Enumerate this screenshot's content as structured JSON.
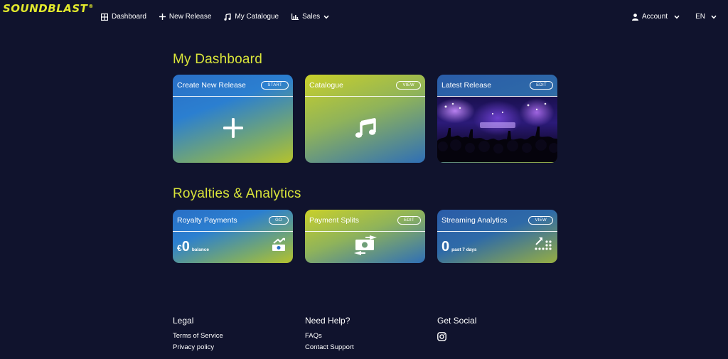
{
  "brand": {
    "logo": "SOUNDBLAST",
    "reg": "®",
    "accent": "#d9e43a",
    "background": "#10132d"
  },
  "nav": {
    "items": [
      {
        "label": "Dashboard",
        "icon": "grid-icon"
      },
      {
        "label": "New Release",
        "icon": "plus-icon"
      },
      {
        "label": "My Catalogue",
        "icon": "music-note-icon"
      },
      {
        "label": "Sales",
        "icon": "bar-chart-icon"
      }
    ],
    "account_label": "Account",
    "language_label": "EN"
  },
  "dashboard": {
    "title": "My Dashboard",
    "cards": [
      {
        "title": "Create New Release",
        "action": "START",
        "icon": "plus-icon"
      },
      {
        "title": "Catalogue",
        "action": "VIEW",
        "icon": "music-note-icon"
      },
      {
        "title": "Latest Release",
        "action": "EDIT",
        "icon": "concert-photo"
      }
    ]
  },
  "royalties": {
    "title": "Royalties & Analytics",
    "cards": [
      {
        "title": "Royalty Payments",
        "action": "GO",
        "currency": "€",
        "value": "0",
        "unit": "balance",
        "icon": "money-growth-icon"
      },
      {
        "title": "Payment Splits",
        "action": "EDIT",
        "icon": "money-transfer-icon"
      },
      {
        "title": "Streaming Analytics",
        "action": "VIEW",
        "value": "0",
        "unit": "past 7 days",
        "icon": "dot-chart-icon"
      }
    ]
  },
  "footer": {
    "legal": {
      "title": "Legal",
      "links": [
        "Terms of Service",
        "Privacy policy"
      ]
    },
    "help": {
      "title": "Need Help?",
      "links": [
        "FAQs",
        "Contact Support"
      ]
    },
    "social": {
      "title": "Get Social",
      "icon": "instagram-icon"
    }
  }
}
